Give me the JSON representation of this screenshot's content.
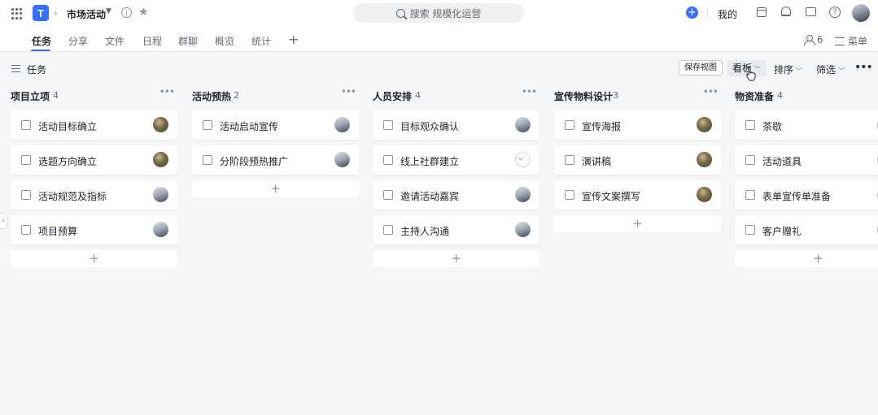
{
  "header": {
    "project_name": "市场活动",
    "search_placeholder": "搜索 规模化运营",
    "mine_label": "我的"
  },
  "tabs": [
    {
      "label": "任务",
      "active": true
    },
    {
      "label": "分享"
    },
    {
      "label": "文件"
    },
    {
      "label": "日程"
    },
    {
      "label": "群聊"
    },
    {
      "label": "概览"
    },
    {
      "label": "统计"
    }
  ],
  "members_count": "6",
  "menu_label": "菜单",
  "viewbar": {
    "title": "任务",
    "save_view": "保存视图",
    "board": "看板",
    "sort": "排序",
    "filter": "筛选"
  },
  "columns": [
    {
      "title": "项目立项",
      "count": "4",
      "cards": [
        {
          "label": "活动目标确立",
          "avatar": "a"
        },
        {
          "label": "选题方向确立",
          "avatar": "a"
        },
        {
          "label": "活动规范及指标",
          "avatar": "b"
        },
        {
          "label": "项目预算",
          "avatar": "b"
        }
      ]
    },
    {
      "title": "活动预热",
      "count": "2",
      "cards": [
        {
          "label": "活动启动宣传",
          "avatar": "b"
        },
        {
          "label": "分阶段预热推广",
          "avatar": "b"
        }
      ]
    },
    {
      "title": "人员安排",
      "count": "4",
      "cards": [
        {
          "label": "目标观众确认",
          "avatar": "b"
        },
        {
          "label": "线上社群建立",
          "avatar": "c"
        },
        {
          "label": "邀请活动嘉宾",
          "avatar": "b"
        },
        {
          "label": "主持人沟通",
          "avatar": "b"
        }
      ]
    },
    {
      "title": "宣传物料设计",
      "count": "3",
      "cards": [
        {
          "label": "宣传海报",
          "avatar": "a"
        },
        {
          "label": "演讲稿",
          "avatar": "a"
        },
        {
          "label": "宣传文案撰写",
          "avatar": "a"
        }
      ]
    },
    {
      "title": "物资准备",
      "count": "4",
      "cards": [
        {
          "label": "茶歇",
          "avatar": "b"
        },
        {
          "label": "活动道具",
          "avatar": "b"
        },
        {
          "label": "表单宣传单准备",
          "avatar": "b"
        },
        {
          "label": "客户赠礼",
          "avatar": "b"
        }
      ]
    }
  ],
  "colors": {
    "accent": "#3370ff",
    "background": "#f5f6f7"
  }
}
